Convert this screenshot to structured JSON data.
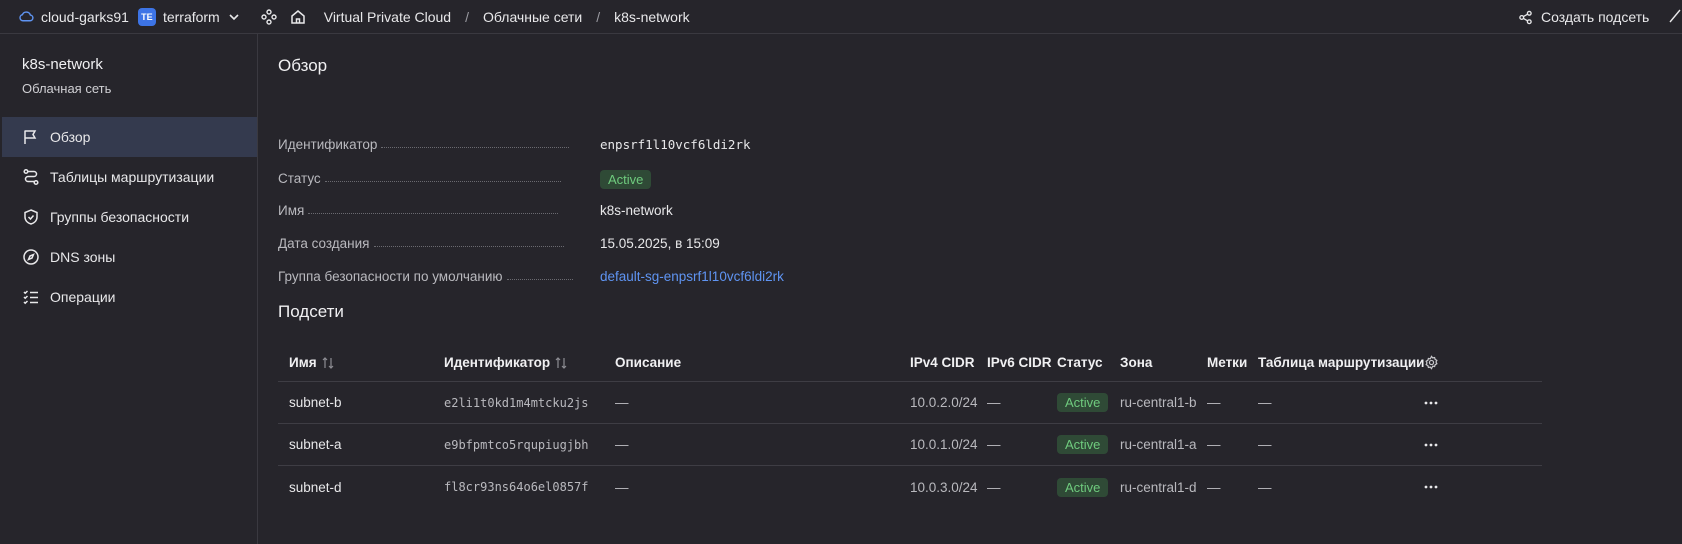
{
  "topbar": {
    "cloud_name": "cloud-garks91",
    "folder_badge": "TE",
    "folder_name": "terraform",
    "breadcrumbs": [
      "Virtual Private Cloud",
      "Облачные сети",
      "k8s-network"
    ],
    "breadcrumb_sep": "/",
    "create_subnet_label": "Создать подсеть"
  },
  "sidebar": {
    "title": "k8s-network",
    "subtitle": "Облачная сеть",
    "items": [
      {
        "label": "Обзор",
        "icon": "flag-icon",
        "active": true
      },
      {
        "label": "Таблицы маршрутизации",
        "icon": "route-icon",
        "active": false
      },
      {
        "label": "Группы безопасности",
        "icon": "shield-icon",
        "active": false
      },
      {
        "label": "DNS зоны",
        "icon": "compass-icon",
        "active": false
      },
      {
        "label": "Операции",
        "icon": "list-check-icon",
        "active": false
      }
    ]
  },
  "overview": {
    "heading": "Обзор",
    "fields": [
      {
        "key": "Идентификатор",
        "value": "enpsrf1l10vcf6ldi2rk"
      },
      {
        "key": "Статус",
        "value": "Active"
      },
      {
        "key": "Имя",
        "value": "k8s-network"
      },
      {
        "key": "Дата создания",
        "value": "15.05.2025, в 15:09"
      },
      {
        "key": "Группа безопасности по умолчанию",
        "value": "default-sg-enpsrf1l10vcf6ldi2rk"
      }
    ]
  },
  "subnets": {
    "heading": "Подсети",
    "columns": [
      "Имя",
      "Идентификатор",
      "Описание",
      "IPv4 CIDR",
      "IPv6 CIDR",
      "Статус",
      "Зона",
      "Метки",
      "Таблица маршрутизации"
    ],
    "rows": [
      {
        "name": "subnet-b",
        "id": "e2li1t0kd1m4mtcku2js",
        "description": "—",
        "ipv4": "10.0.2.0/24",
        "ipv6": "—",
        "status": "Active",
        "zone": "ru-central1-b",
        "labels": "—",
        "route_table": "—"
      },
      {
        "name": "subnet-a",
        "id": "e9bfpmtco5rqupiugjbh",
        "description": "—",
        "ipv4": "10.0.1.0/24",
        "ipv6": "—",
        "status": "Active",
        "zone": "ru-central1-a",
        "labels": "—",
        "route_table": "—"
      },
      {
        "name": "subnet-d",
        "id": "fl8cr93ns64o6el0857f",
        "description": "—",
        "ipv4": "10.0.3.0/24",
        "ipv6": "—",
        "status": "Active",
        "zone": "ru-central1-d",
        "labels": "—",
        "route_table": "—"
      }
    ]
  },
  "colors": {
    "background": "#26252b",
    "active_nav": "#343a4e",
    "link": "#5f94f2",
    "status_active_bg": "#2f4a36",
    "status_active_text": "#6fcb7e",
    "folder_badge": "#3d74e6"
  }
}
